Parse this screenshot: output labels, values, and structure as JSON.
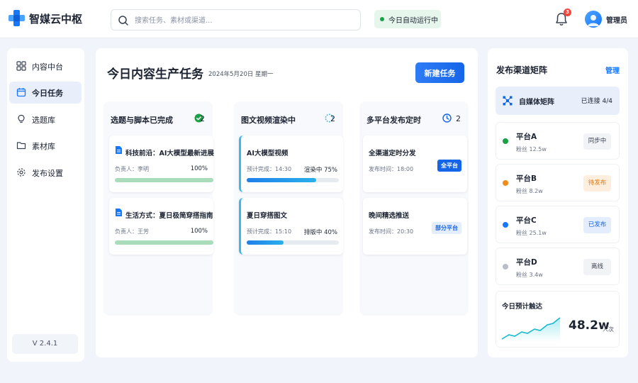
{
  "app": {
    "name": "智媒云中枢"
  },
  "search": {
    "placeholder": "搜索任务、素材或渠道..."
  },
  "status": {
    "text": "今日自动运行中",
    "color": "#19a148"
  },
  "notifications": {
    "count": "3",
    "icon": "bell-icon"
  },
  "user": {
    "name": "管理员"
  },
  "sidebar": {
    "items": [
      {
        "label": "内容中台",
        "icon": "grid-icon"
      },
      {
        "label": "今日任务",
        "icon": "calendar-icon",
        "active": true
      },
      {
        "label": "选题库",
        "icon": "lightbulb-icon"
      },
      {
        "label": "素材库",
        "icon": "folder-icon"
      },
      {
        "label": "发布设置",
        "icon": "gear-icon"
      }
    ],
    "version": "V 2.4.1"
  },
  "main": {
    "title": "今日内容生产任务",
    "date": "2024年5月20日  星期一",
    "new_button": "新建任务",
    "columns": [
      {
        "title": "选题与脚本已完成",
        "count": "2",
        "icon": "check-circle-icon",
        "cards": [
          {
            "title": "科技前沿：AI大模型最新进展",
            "meta": "负责人：李明",
            "right": "100%",
            "progress": 1.0
          },
          {
            "title": "生活方式：夏日极简穿搭指南",
            "meta": "负责人：王芳",
            "right": "100%",
            "progress": 1.0
          }
        ]
      },
      {
        "title": "图文视频渲染中",
        "count": "2",
        "icon": "spinner-icon",
        "cards": [
          {
            "title": "AI大模型视频",
            "meta": "预计完成：14:30",
            "right": "渲染中  75%",
            "progress": 0.75
          },
          {
            "title": "夏日穿搭图文",
            "meta": "预计完成：15:10",
            "right": "排版中  40%",
            "progress": 0.4
          }
        ]
      },
      {
        "title": "多平台发布定时",
        "count": "2",
        "icon": "clock-icon",
        "cards": [
          {
            "title": "全渠道定时分发",
            "meta": "发布时间：18:00",
            "tag": "全平台"
          },
          {
            "title": "晚间精选推送",
            "meta": "发布时间：20:30",
            "tag": "部分平台"
          }
        ]
      }
    ]
  },
  "channels": {
    "title": "发布渠道矩阵",
    "manage": "管理",
    "matrix": {
      "label": "自媒体矩阵",
      "status": "已连接  4/4"
    },
    "platforms": [
      {
        "name": "平台A",
        "fans": "粉丝  12.5w",
        "status": "同步中",
        "dot": "#19a148"
      },
      {
        "name": "平台B",
        "fans": "粉丝  8.2w",
        "status": "待发布",
        "dot": "#f28a1a"
      },
      {
        "name": "平台C",
        "fans": "粉丝  25.1w",
        "status": "已发布",
        "dot": "#1677ff"
      },
      {
        "name": "平台D",
        "fans": "粉丝  3.4w",
        "status": "离线",
        "dot": "#b9bec8"
      }
    ],
    "reach": {
      "label": "今日预计触达",
      "value": "48.2w",
      "unit": "人次"
    }
  }
}
